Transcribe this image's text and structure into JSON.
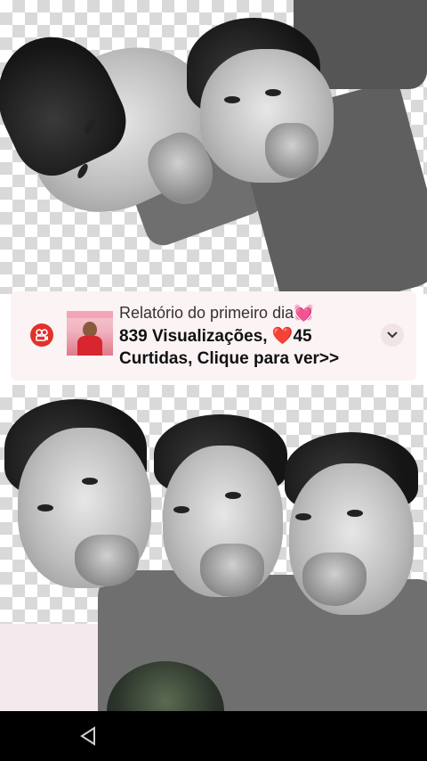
{
  "notification": {
    "title": "Relatório do primeiro dia💓",
    "body": "839 Visualizações, ❤️45 Curtidas, Clique para ver>>",
    "app_icon": "kwai-icon",
    "thumbnail": "girl-photo-thumbnail",
    "expand_icon": "chevron-down-icon",
    "badge_color": "#e0322a"
  },
  "navigation": {
    "back_icon": "back-triangle-icon"
  },
  "stickers": {
    "top_count": 2,
    "bottom_count": 3
  }
}
